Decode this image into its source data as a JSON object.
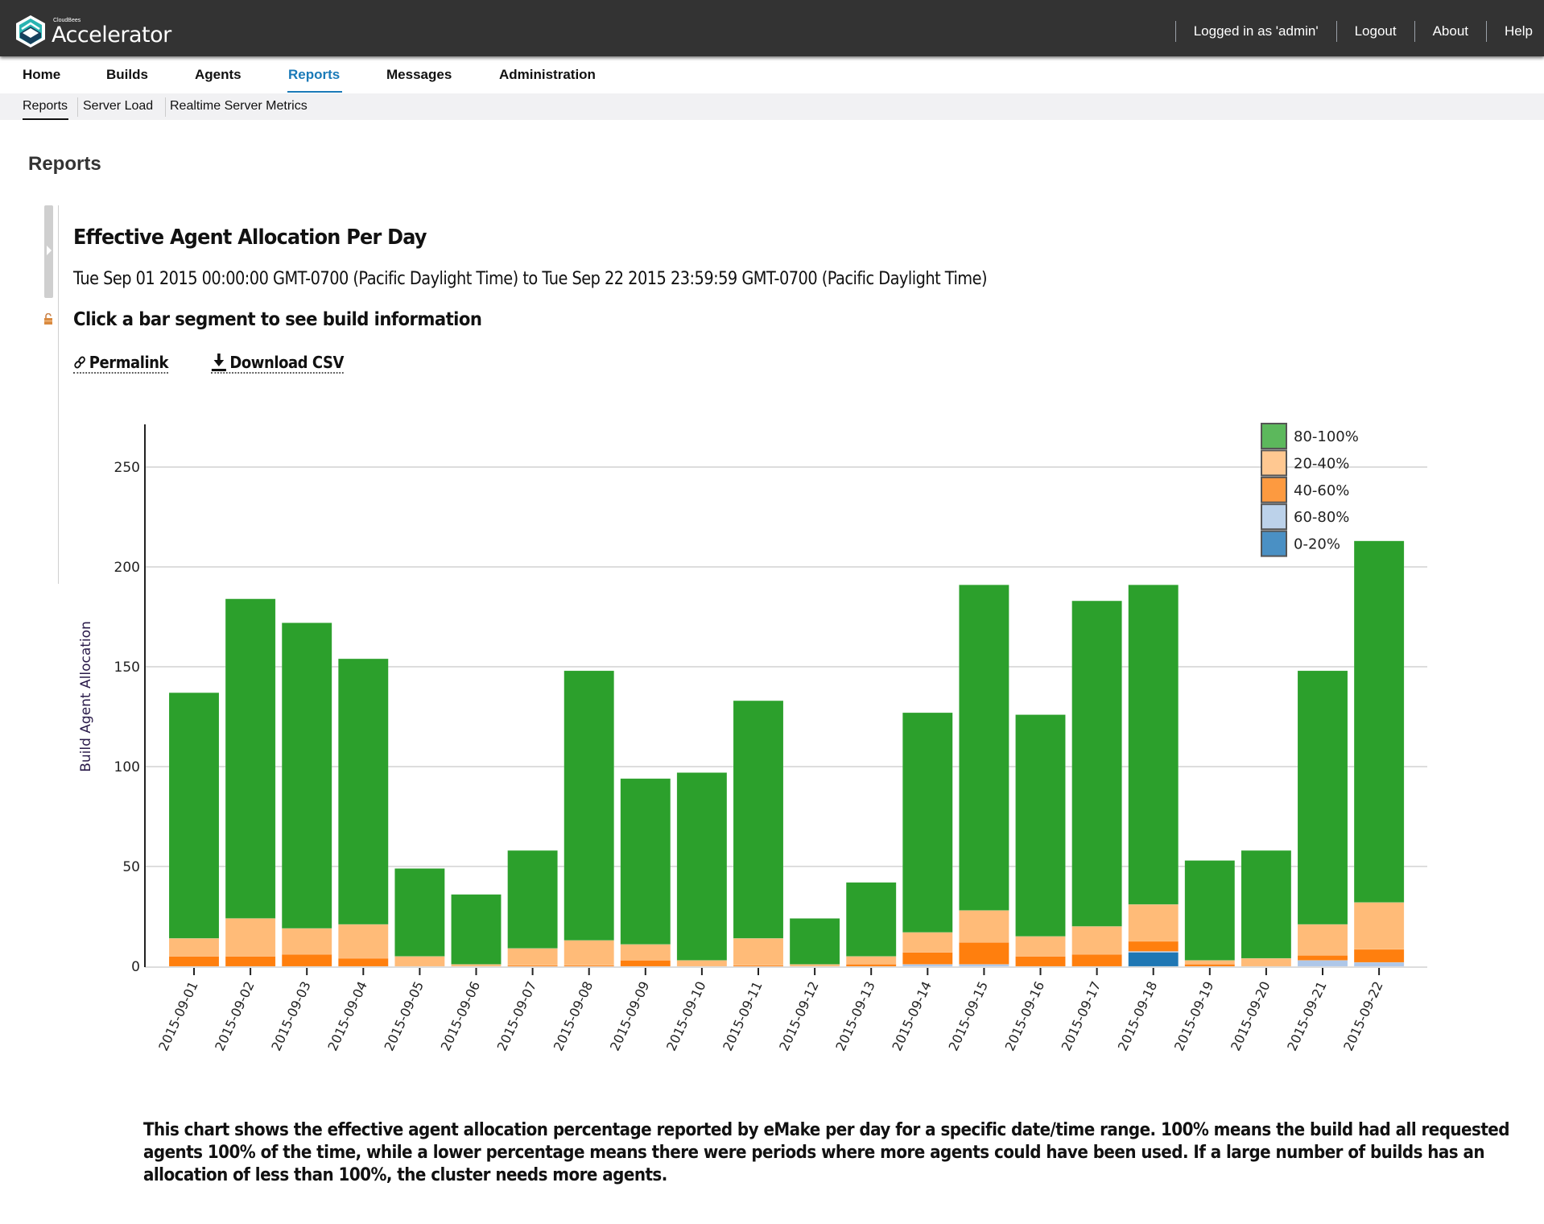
{
  "header": {
    "brand_company": "CloudBees",
    "brand_product": "Accelerator",
    "logged_in": "Logged in as 'admin'",
    "logout": "Logout",
    "about": "About",
    "help": "Help"
  },
  "nav": {
    "items": [
      {
        "label": "Home"
      },
      {
        "label": "Builds"
      },
      {
        "label": "Agents"
      },
      {
        "label": "Reports",
        "active": true
      },
      {
        "label": "Messages"
      },
      {
        "label": "Administration"
      }
    ]
  },
  "subnav": {
    "items": [
      {
        "label": "Reports",
        "active": true
      },
      {
        "label": "Server Load"
      },
      {
        "label": "Realtime Server Metrics"
      }
    ]
  },
  "page": {
    "title": "Reports"
  },
  "report": {
    "title": "Effective Agent Allocation Per Day",
    "range": "Tue Sep 01 2015 00:00:00 GMT-0700 (Pacific Daylight Time) to Tue Sep 22 2015 23:59:59 GMT-0700 (Pacific Daylight Time)",
    "hint": "Click a bar segment to see build information",
    "permalink_label": "Permalink",
    "download_label": "Download CSV",
    "description": "This chart shows the effective agent allocation percentage reported by eMake per day for a specific date/time range. 100% means the build had all requested agents 100% of the time, while a lower percentage means there were periods where more agents could have been used. If a large number of builds has an allocation of less than 100%, the cluster needs more agents."
  },
  "chart_data": {
    "type": "bar",
    "stacked": true,
    "title": "",
    "xlabel": "",
    "ylabel": "Build Agent Allocation",
    "ylim": [
      0,
      270
    ],
    "yticks": [
      0,
      50,
      100,
      150,
      200,
      250
    ],
    "grid": true,
    "legend_position": "top-right",
    "categories": [
      "2015-09-01",
      "2015-09-02",
      "2015-09-03",
      "2015-09-04",
      "2015-09-05",
      "2015-09-06",
      "2015-09-07",
      "2015-09-08",
      "2015-09-09",
      "2015-09-10",
      "2015-09-11",
      "2015-09-12",
      "2015-09-13",
      "2015-09-14",
      "2015-09-15",
      "2015-09-16",
      "2015-09-17",
      "2015-09-18",
      "2015-09-19",
      "2015-09-20",
      "2015-09-21",
      "2015-09-22"
    ],
    "legend_order": [
      "80-100%",
      "20-40%",
      "40-60%",
      "60-80%",
      "0-20%"
    ],
    "series": [
      {
        "name": "0-20%",
        "color": "#1f77b4",
        "legend_color": "#4a90c4",
        "values": [
          0,
          0,
          0,
          0,
          0,
          0,
          0,
          0,
          0,
          0,
          0,
          0,
          0,
          0,
          0,
          0,
          0,
          7,
          0,
          0,
          0,
          0
        ]
      },
      {
        "name": "60-80%",
        "color": "#aec7e8",
        "legend_color": "#bcd2ea",
        "values": [
          0,
          0,
          0,
          0,
          0,
          0,
          0,
          0,
          0,
          0,
          0,
          0,
          0,
          1,
          1,
          0,
          0,
          0.5,
          0,
          0,
          3,
          2
        ]
      },
      {
        "name": "40-60%",
        "color": "#ff7f0e",
        "legend_color": "#fd9a40",
        "values": [
          5,
          5,
          6,
          4,
          0,
          0,
          0.5,
          0.5,
          3,
          0,
          0.5,
          0,
          1,
          6,
          11,
          5,
          6,
          5,
          1,
          0,
          2.5,
          6.5
        ]
      },
      {
        "name": "20-40%",
        "color": "#ffbb78",
        "legend_color": "#ffc891",
        "values": [
          9,
          19,
          13,
          17,
          5,
          1,
          8.5,
          12.5,
          8,
          3,
          13.5,
          1,
          4,
          10,
          16,
          10,
          14,
          18.5,
          2,
          4,
          15.5,
          23.5
        ]
      },
      {
        "name": "80-100%",
        "color": "#2ca02c",
        "legend_color": "#5cb85c",
        "values": [
          123,
          160,
          153,
          133,
          44,
          35,
          49,
          135,
          83,
          94,
          119,
          23,
          37,
          110,
          163,
          111,
          163,
          160,
          50,
          54,
          127,
          181
        ]
      }
    ]
  }
}
